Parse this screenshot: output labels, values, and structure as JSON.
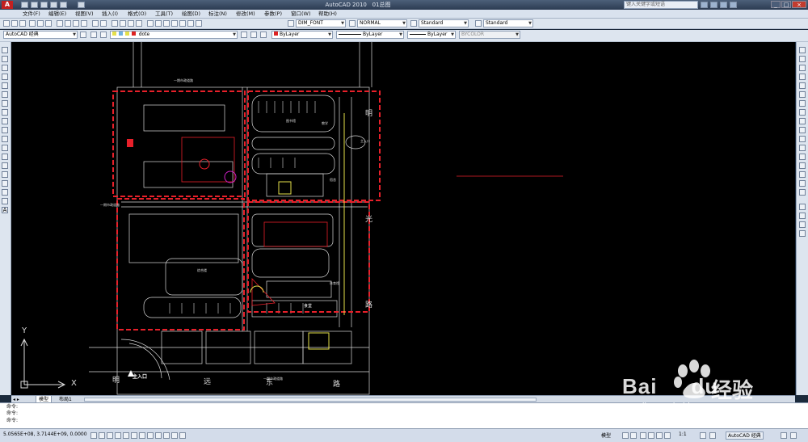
{
  "window": {
    "title": "AutoCAD 2010",
    "title_suffix": "01总图",
    "search_placeholder": "键入关键字或短语"
  },
  "menu": [
    "文件(F)",
    "编辑(E)",
    "视图(V)",
    "插入(I)",
    "格式(O)",
    "工具(T)",
    "绘图(D)",
    "标注(N)",
    "修改(M)",
    "参数(P)",
    "窗口(W)",
    "帮助(H)"
  ],
  "toolbar_styles": {
    "text_style": "DIM_FONT",
    "dim_style": "NORMAL",
    "table_style": "Standard",
    "multileader_style": "Standard"
  },
  "toolbar_layers": {
    "workspace": "AutoCAD 经典",
    "current_layer": "dote",
    "color": "ByLayer",
    "linetype": "ByLayer",
    "lineweight": "ByLayer",
    "plot_style": "BYCOLOR"
  },
  "drawing": {
    "ucs_y": "Y",
    "ucs_x": "X",
    "main_entrance": "主入口",
    "entrance_east": "主入口",
    "road_labels": [
      "明",
      "远",
      "东",
      "路"
    ],
    "side_labels": [
      "明",
      "光",
      "路"
    ],
    "road_name_top": "一期市政道路",
    "road_name_bottom": "一期市政道路",
    "road_name_left": "一期市政道路",
    "building_labels": [
      "教学",
      "宿舍",
      "体育馆",
      "食堂",
      "综合楼",
      "图书馆"
    ]
  },
  "layout_tabs": [
    "模型",
    "布局1"
  ],
  "command": {
    "lines": [
      "命令:",
      "命令:",
      "命令:"
    ]
  },
  "status": {
    "coordinates": "5.0565E+08, 3.7144E+09, 0.0000",
    "model_label": "模型",
    "scale": "1:1",
    "workspace": "AutoCAD 经典"
  },
  "watermark": {
    "brand": "Bai",
    "brand2": "du",
    "chinese": "经验",
    "url": "jingyan.baidu.com"
  },
  "colors": {
    "canvas": "#000000",
    "highlight": "#e8202a",
    "linework": "#d8d8d8",
    "accent_yellow": "#e5e04a",
    "accent_magenta": "#d020c8"
  }
}
